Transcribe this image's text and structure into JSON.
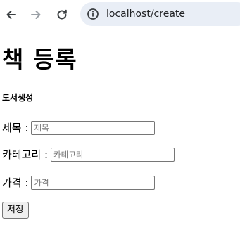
{
  "browser": {
    "url": "localhost/create",
    "back_icon": "arrow-left-icon",
    "forward_icon": "arrow-right-icon",
    "reload_icon": "reload-icon",
    "site_info_icon": "info-icon"
  },
  "page": {
    "title": "책 등록",
    "section_title": "도서생성",
    "form": {
      "fields": [
        {
          "label": "제목 :",
          "placeholder": "제목",
          "value": ""
        },
        {
          "label": "카테고리 :",
          "placeholder": "카테고리",
          "value": ""
        },
        {
          "label": "가격 :",
          "placeholder": "가격",
          "value": ""
        }
      ],
      "submit_label": "저장"
    }
  },
  "colors": {
    "omnibox_bg": "#e9eef6",
    "icon_active": "#3c4043",
    "icon_disabled": "#9aa0a6"
  }
}
